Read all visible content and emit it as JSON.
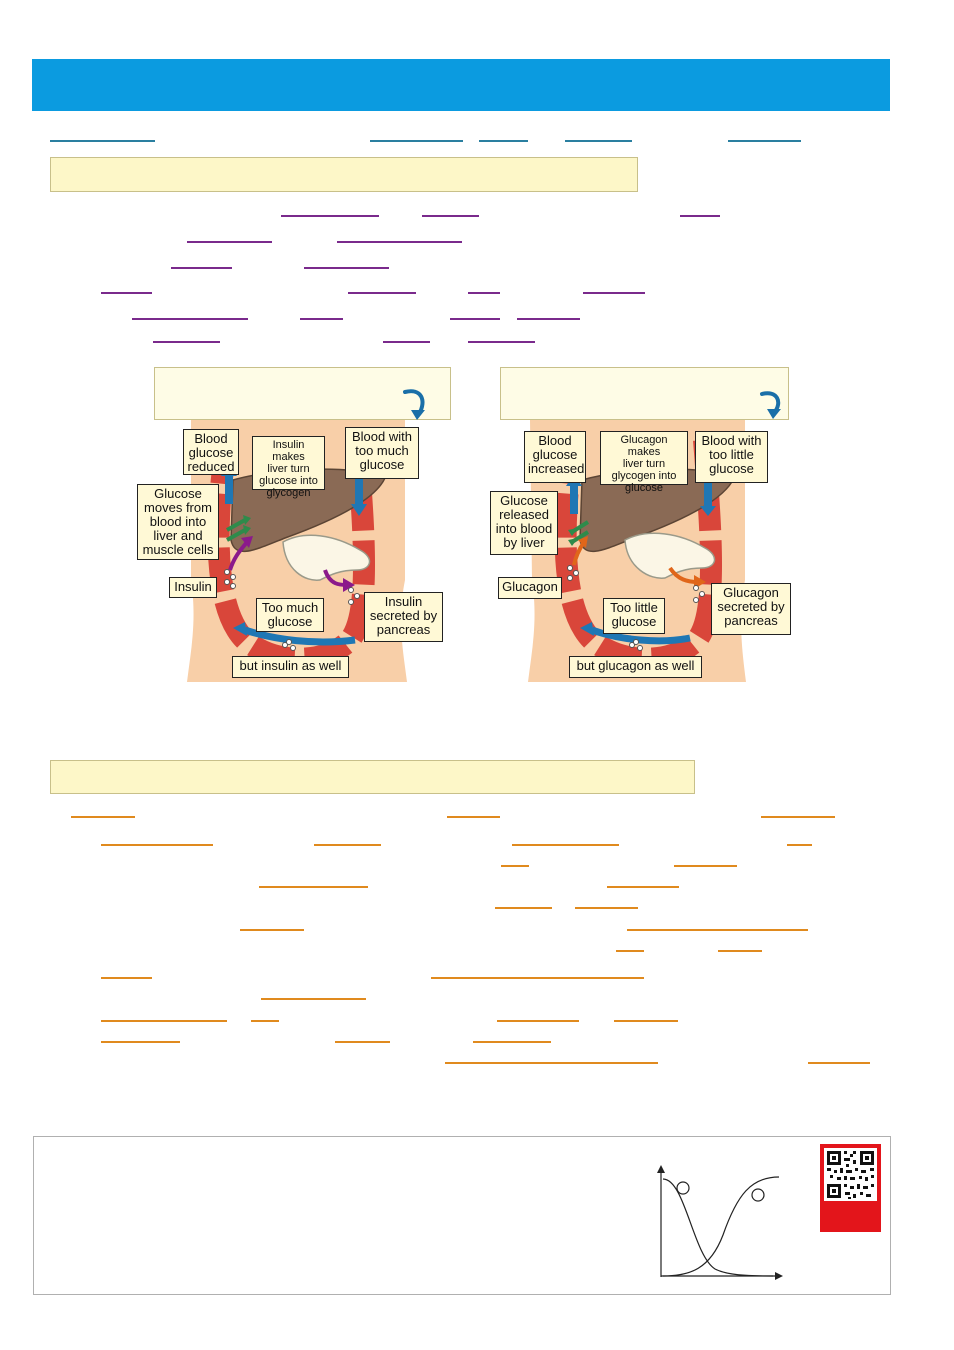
{
  "diagram": {
    "left": {
      "labels": {
        "reduced": "Blood\nglucose\nreduced",
        "liver_action": "Insulin makes\nliver turn\nglucose into\nglycogen",
        "too_much": "Blood with\ntoo much\nglucose",
        "moves": "Glucose\nmoves from\nblood into\nliver and\nmuscle cells",
        "hormone": "Insulin",
        "gut": "Too much\nglucose",
        "secreted": "Insulin\nsecreted by\npancreas",
        "bottom": "but insulin as well"
      }
    },
    "right": {
      "labels": {
        "increased": "Blood\nglucose\nincreased",
        "liver_action": "Glucagon makes\nliver turn\nglycogen into\nglucose",
        "too_little": "Blood with\ntoo little\nglucose",
        "released": "Glucose\nreleased\ninto blood\nby liver",
        "hormone": "Glucagon",
        "gut": "Too little\nglucose",
        "secreted": "Glucagon\nsecreted by\npancreas",
        "bottom": "but glucagon as well"
      }
    }
  },
  "colors": {
    "header": "#0b9be0",
    "underline_teal": "#2a7fa0",
    "underline_purple": "#7a2a8c",
    "underline_orange": "#e08a1e",
    "body_skin": "#f8cfa8",
    "blood_vessel": "#d9463a",
    "liver": "#8a6a55",
    "label_bg": "#fff9d6",
    "qr_frame": "#e3151b"
  },
  "icons": {
    "curved_arrow": "curved-arrow-icon",
    "qr": "qr-code-icon"
  }
}
